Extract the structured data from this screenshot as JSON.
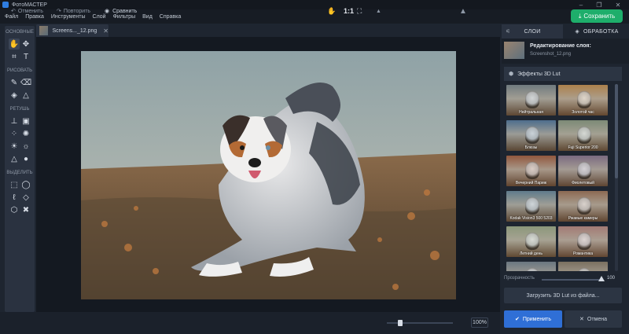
{
  "app": {
    "title": "ФотоМАСТЕР"
  },
  "window_controls": {
    "minimize": "–",
    "maximize": "❐",
    "close": "✕"
  },
  "menu": [
    "Файл",
    "Правка",
    "Инструменты",
    "Слой",
    "Фильтры",
    "Вид",
    "Справка"
  ],
  "save_button": {
    "label": "Сохранить"
  },
  "toolbox": {
    "sections": [
      "ОСНОВНЫЕ",
      "РИСОВАТЬ",
      "РЕТУШЬ",
      "ВЫДЕЛИТЬ"
    ]
  },
  "document_tab": {
    "name": "Screens..._12.png",
    "close": "✕"
  },
  "bottom_bar": {
    "undo": "Отменить",
    "redo": "Повторить",
    "compare": "Сравнить",
    "ratio": "1:1",
    "zoom": "100%",
    "zoom_level": 0.2
  },
  "right_panel": {
    "tabs": [
      {
        "label": "СЛОИ"
      },
      {
        "label": "ОБРАБОТКА"
      }
    ],
    "layer_title": "Редактирование слоя:",
    "layer_file": "Screenshot_12.png",
    "effects_header": "Эффекты 3D Lut",
    "luts": [
      {
        "label": "Нейтральная",
        "tint": "#7f8a8e"
      },
      {
        "label": "Золотой час",
        "tint": "#b8905a"
      },
      {
        "label": "Блюзы",
        "tint": "#5c7d9c"
      },
      {
        "label": "Fuji Superior 200",
        "tint": "#8c9986"
      },
      {
        "label": "Вечерний Париж",
        "tint": "#a0664a"
      },
      {
        "label": "Фиолетовый",
        "tint": "#8a7a90"
      },
      {
        "label": "Kodak Vision3 500 5203",
        "tint": "#6f8b9a"
      },
      {
        "label": "Ржавые камеры",
        "tint": "#9c7a62"
      },
      {
        "label": "Летний день",
        "tint": "#9aa68a"
      },
      {
        "label": "Романтика",
        "tint": "#b08a84"
      },
      {
        "label": "",
        "tint": "#7a8690"
      },
      {
        "label": "",
        "tint": "#8a8070"
      }
    ],
    "opacity_label": "Прозрачность",
    "opacity_value": "100",
    "load_button": "Загрузить 3D Lut из файла...",
    "apply_button": "Применить",
    "cancel_button": "Отмена"
  },
  "colors": {
    "accent_green": "#1eae6b",
    "accent_blue": "#2f6fd6",
    "bg": "#1e2530"
  }
}
